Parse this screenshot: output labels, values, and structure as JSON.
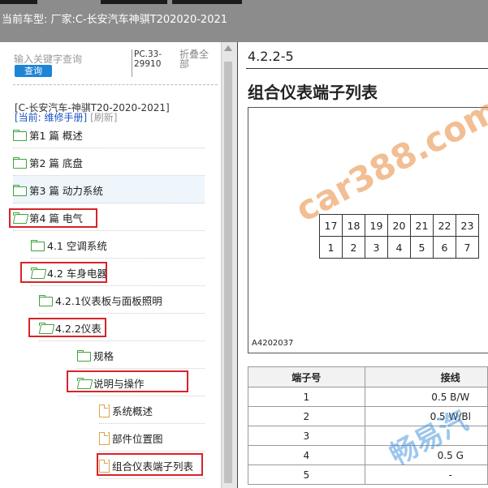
{
  "header": {
    "title": "当前车型:  厂家:C-长安汽车神骐T202020-2021"
  },
  "search": {
    "placeholder": "输入关键字查询",
    "button_label": "查询",
    "code": "PC.33-29910",
    "collapse_label": "折叠全部"
  },
  "breadcrumb": {
    "vehicle": "[C-长安汽车-神骐T20-2020-2021]",
    "current": "[当前: 维修手册]",
    "refresh": "[刷新]"
  },
  "tree": {
    "items": [
      {
        "label": "第1 篇 概述",
        "icon": "folder-icon"
      },
      {
        "label": "第2 篇 底盘",
        "icon": "folder-icon"
      },
      {
        "label": "第3 篇 动力系统",
        "icon": "folder-icon"
      },
      {
        "label": "第4 篇 电气",
        "icon": "folder-open-icon"
      },
      {
        "label": "4.1 空调系统",
        "icon": "folder-icon"
      },
      {
        "label": "4.2 车身电器",
        "icon": "folder-open-icon"
      },
      {
        "label": "4.2.1仪表板与面板照明",
        "icon": "folder-icon"
      },
      {
        "label": "4.2.2仪表",
        "icon": "folder-open-icon"
      },
      {
        "label": "规格",
        "icon": "folder-icon"
      },
      {
        "label": "说明与操作",
        "icon": "folder-open-icon"
      },
      {
        "label": "系统概述",
        "icon": "document-icon"
      },
      {
        "label": "部件位置图",
        "icon": "document-icon"
      },
      {
        "label": "组合仪表端子列表",
        "icon": "document-icon"
      }
    ]
  },
  "content": {
    "section_number": "4.2.2-5",
    "title": "组合仪表端子列表",
    "connector": {
      "top_row": [
        "17",
        "18",
        "19",
        "20",
        "21",
        "22",
        "23"
      ],
      "bottom_row": [
        "1",
        "2",
        "3",
        "4",
        "5",
        "6",
        "7"
      ]
    },
    "diagram_code": "A4202037",
    "table": {
      "headers": [
        "端子号",
        "接线"
      ],
      "rows": [
        [
          "1",
          "0.5 B/W"
        ],
        [
          "2",
          "0.5 W/Bl"
        ],
        [
          "3",
          ""
        ],
        [
          "4",
          "0.5 G"
        ],
        [
          "5",
          "-"
        ]
      ]
    }
  },
  "watermarks": {
    "site": "car388.com",
    "brand": "畅易汽"
  },
  "colors": {
    "header_bg": "#8c8c8c",
    "highlight_box": "#d8232a",
    "button_blue": "#1e84d6",
    "folder_green": "#3fa33f",
    "doc_orange": "#e0a34a",
    "watermark_blue": "#3b8fd9",
    "watermark_orange": "#e8893a"
  }
}
